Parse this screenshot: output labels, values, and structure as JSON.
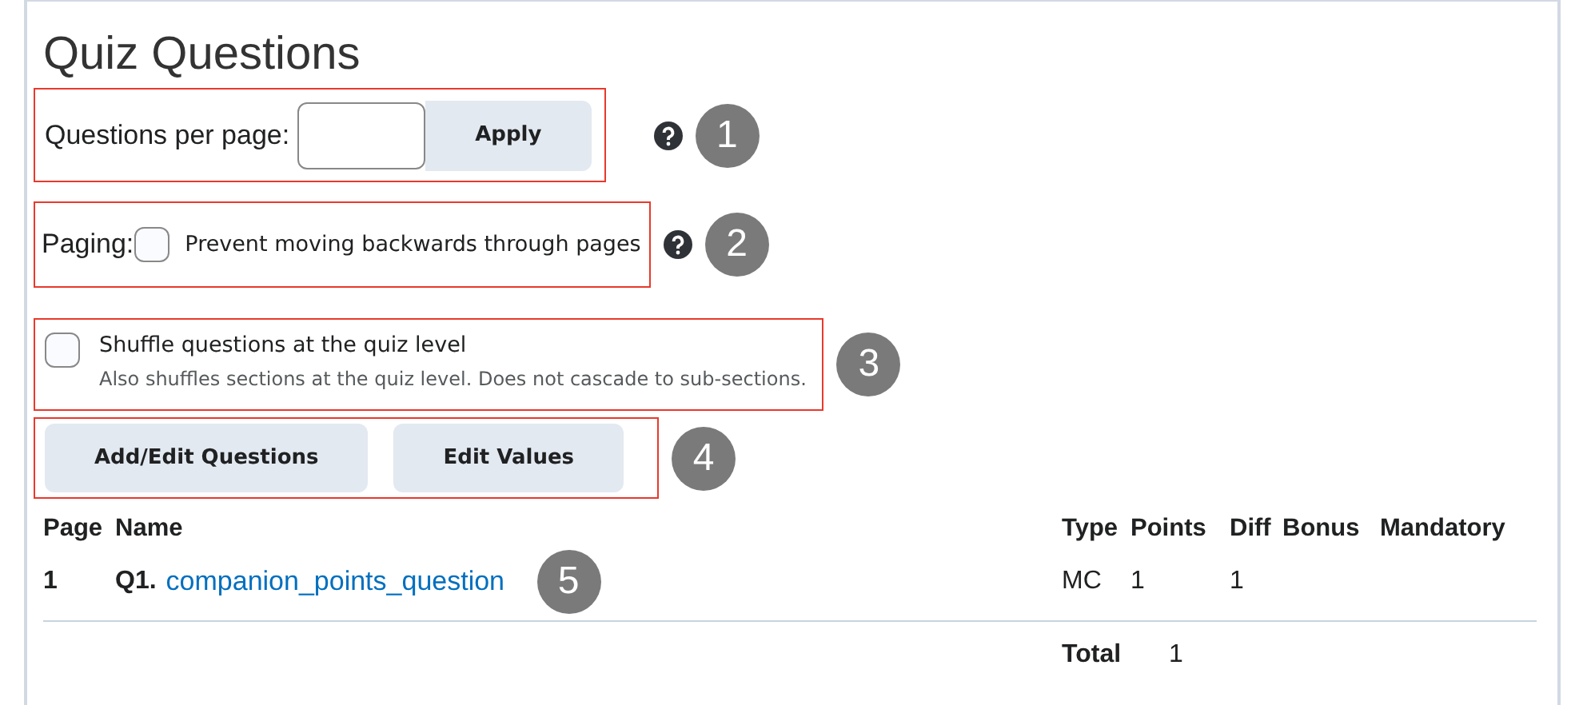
{
  "title": "Quiz Questions",
  "questions_per_page": {
    "label": "Questions per page:",
    "button": "Apply",
    "help": true,
    "callout": "1"
  },
  "paging": {
    "label": "Paging:",
    "checked": false,
    "option": "Prevent moving backwards through pages",
    "help": true,
    "callout": "2"
  },
  "shuffle": {
    "checked": false,
    "label": "Shuffle questions at the quiz level",
    "description": "Also shuffles sections at the quiz level. Does not cascade to sub-sections.",
    "callout": "3"
  },
  "actions": {
    "buttons": [
      "Add/Edit Questions",
      "Edit Values"
    ],
    "callout": "4"
  },
  "table": {
    "columns": [
      "Page",
      "Name",
      "Type",
      "Points",
      "Diff",
      "Bonus",
      "Mandatory"
    ],
    "rows": [
      {
        "page": "1",
        "number": "Q1.",
        "name": "companion_points_question",
        "callout": "5",
        "type": "MC",
        "points": "1",
        "diff": "1"
      }
    ],
    "total": {
      "label": "Total",
      "value": "1"
    }
  }
}
